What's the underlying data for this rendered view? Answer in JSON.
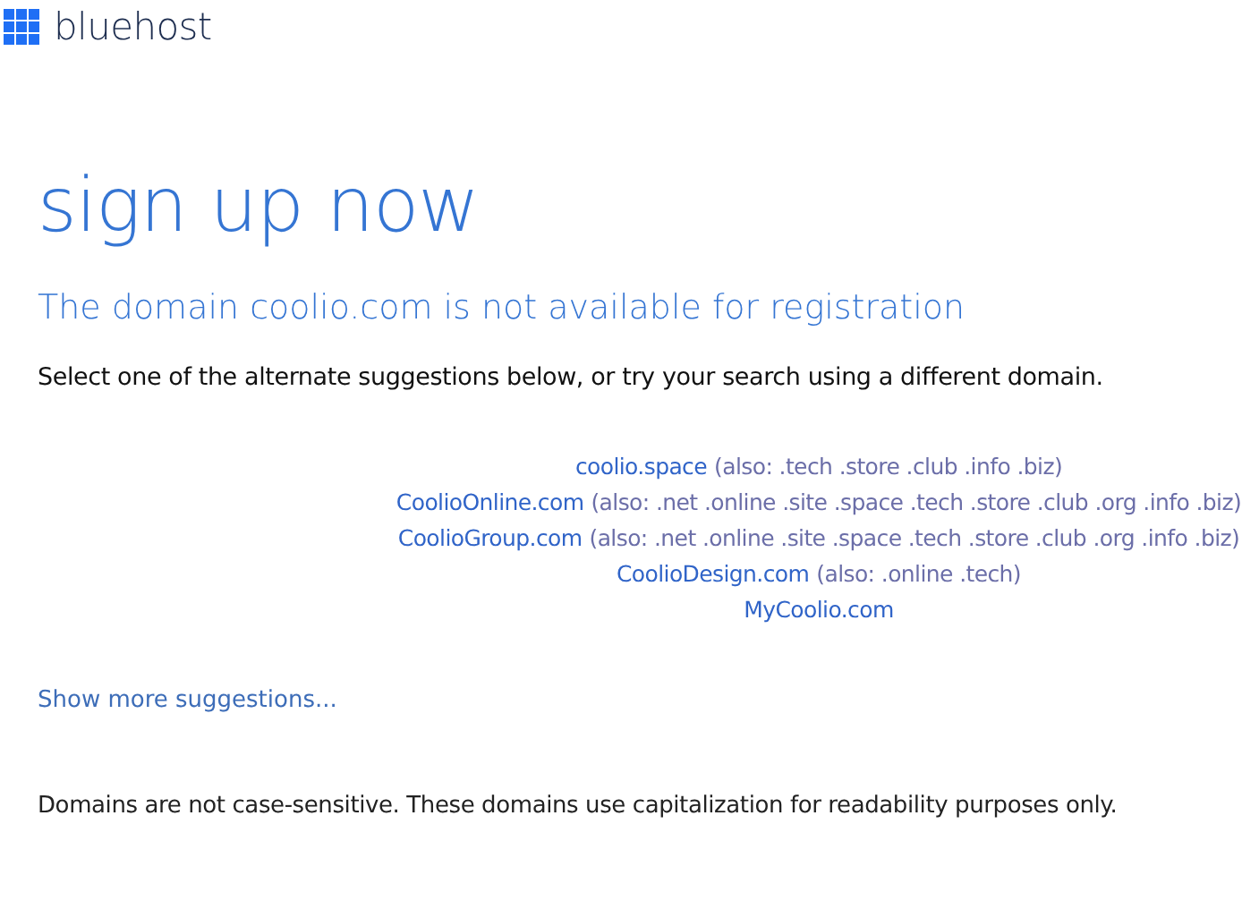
{
  "logo": {
    "text": "bluehost"
  },
  "heading": "sign up now",
  "subheading": "The domain coolio.com is not available for registration",
  "instructions": "Select one of the alternate suggestions below, or try your search using a different domain.",
  "suggestions": [
    {
      "domain": "coolio.space",
      "also": "(also: .tech .store .club .info .biz)"
    },
    {
      "domain": "CoolioOnline.com",
      "also": "(also: .net .online .site .space .tech .store .club .org .info .biz)"
    },
    {
      "domain": "CoolioGroup.com",
      "also": "(also: .net .online .site .space .tech .store .club .org .info .biz)"
    },
    {
      "domain": "CoolioDesign.com",
      "also": "(also: .online .tech)"
    },
    {
      "domain": "MyCoolio.com"
    }
  ],
  "show_more": "Show more suggestions...",
  "footnote": "Domains are not case-sensitive. These domains use capitalization for readability purposes only."
}
